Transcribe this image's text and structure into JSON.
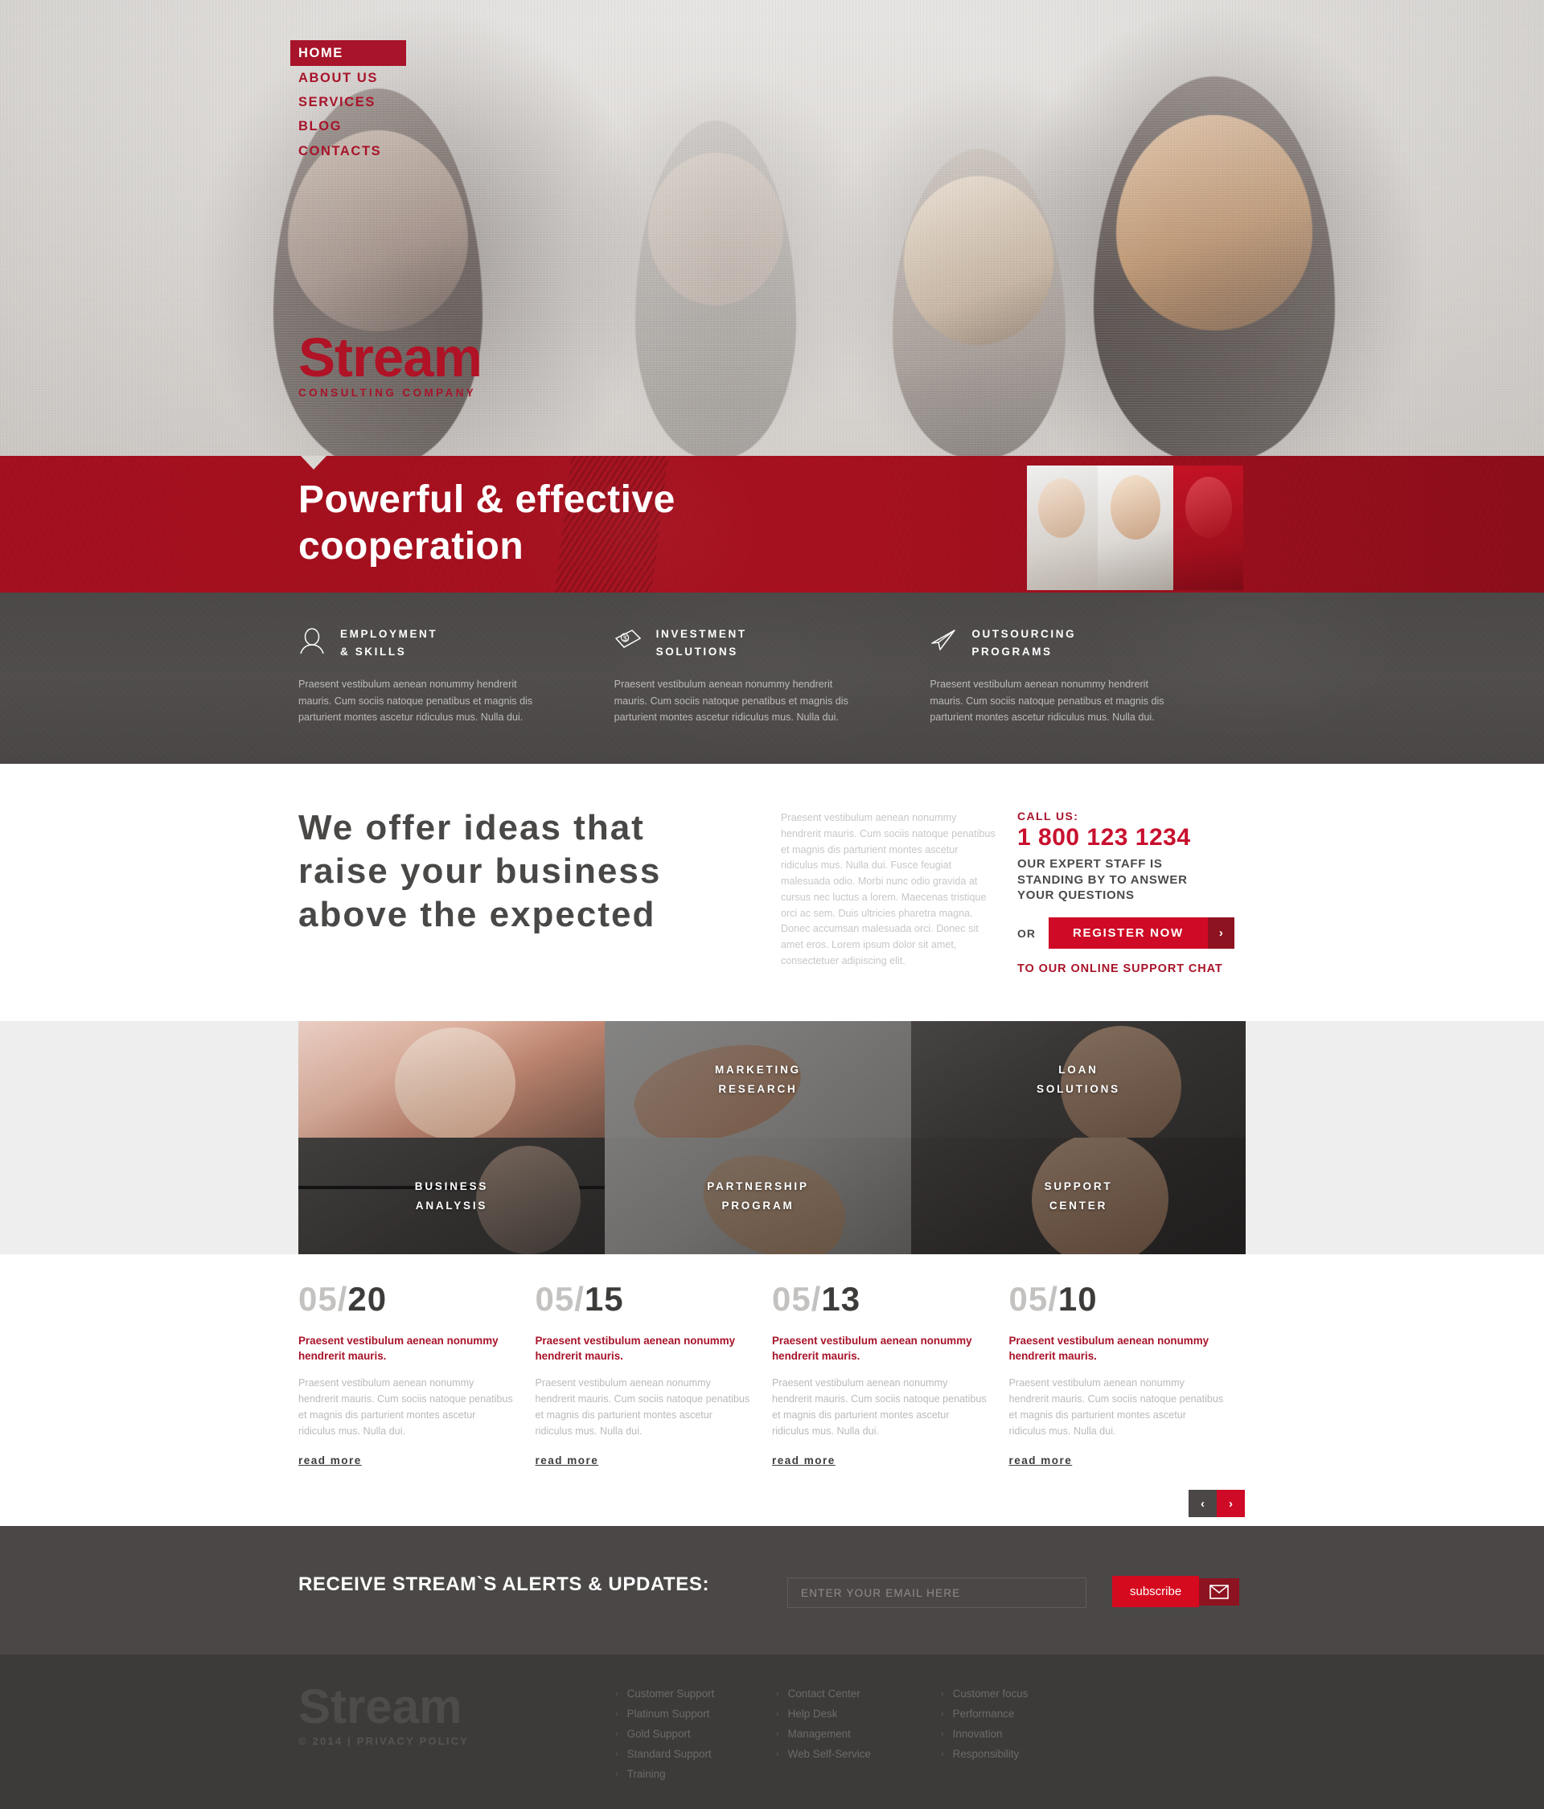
{
  "nav": {
    "items": [
      {
        "label": "HOME",
        "active": true
      },
      {
        "label": "ABOUT US",
        "active": false
      },
      {
        "label": "SERVICES",
        "active": false
      },
      {
        "label": "BLOG",
        "active": false
      },
      {
        "label": "CONTACTS",
        "active": false
      }
    ]
  },
  "logo": {
    "name": "Stream",
    "tagline": "CONSULTING COMPANY"
  },
  "banner": {
    "line1": "Powerful & effective",
    "line2": "cooperation"
  },
  "services": [
    {
      "icon": "person-icon",
      "title_line1": "EMPLOYMENT",
      "title_line2": "& SKILLS",
      "text": "Praesent vestibulum aenean nonummy hendrerit mauris. Cum sociis natoque penatibus et magnis dis parturient montes ascetur ridiculus mus. Nulla dui."
    },
    {
      "icon": "banknote-icon",
      "title_line1": "INVESTMENT",
      "title_line2": "SOLUTIONS",
      "text": "Praesent vestibulum aenean nonummy hendrerit mauris. Cum sociis natoque penatibus et magnis dis parturient montes ascetur ridiculus mus. Nulla dui."
    },
    {
      "icon": "paper-plane-icon",
      "title_line1": "OUTSOURCING",
      "title_line2": "PROGRAMS",
      "text": "Praesent vestibulum aenean nonummy hendrerit mauris. Cum sociis natoque penatibus et magnis dis parturient montes ascetur ridiculus mus. Nulla dui."
    }
  ],
  "offer": {
    "heading_line1": "We offer ideas that",
    "heading_line2": "raise your business",
    "heading_line3": "above the expected",
    "paragraph": "Praesent vestibulum aenean nonummy hendrerit mauris. Cum sociis natoque penatibus et magnis dis parturient montes ascetur ridiculus mus. Nulla dui. Fusce feugiat malesuada odio. Morbi nunc odio gravida at cursus nec luctus a lorem. Maecenas tristique orci ac sem. Duis ultricies pharetra magna. Donec accumsan malesuada orci. Donec sit amet eros. Lorem ipsum dolor sit amet, consectetuer adipiscing elit.",
    "call_label": "CALL US:",
    "phone": "1 800 123 1234",
    "call_desc_line1": "OUR EXPERT STAFF IS",
    "call_desc_line2": "STANDING BY TO ANSWER",
    "call_desc_line3": "YOUR QUESTIONS",
    "or_label": "OR",
    "register_label": "REGISTER NOW",
    "register_arrow": "›",
    "chat_label": "TO OUR ONLINE SUPPORT CHAT"
  },
  "gallery": [
    {
      "caption_line1": "",
      "caption_line2": "",
      "name": "smiling-woman-thumbs-up"
    },
    {
      "caption_line1": "MARKETING",
      "caption_line2": "RESEARCH",
      "name": "marketing-research"
    },
    {
      "caption_line1": "LOAN",
      "caption_line2": "SOLUTIONS",
      "name": "loan-solutions"
    },
    {
      "caption_line1": "BUSINESS",
      "caption_line2": "ANALYSIS",
      "name": "business-analysis"
    },
    {
      "caption_line1": "PARTNERSHIP",
      "caption_line2": "PROGRAM",
      "name": "partnership-program"
    },
    {
      "caption_line1": "SUPPORT",
      "caption_line2": "CENTER",
      "name": "support-center"
    }
  ],
  "news": {
    "items": [
      {
        "month": "05",
        "sep": "/",
        "day": "20",
        "title": "Praesent vestibulum aenean nonummy hendrerit mauris.",
        "text": "Praesent vestibulum aenean nonummy hendrerit mauris. Cum sociis natoque penatibus et magnis dis parturient montes ascetur ridiculus mus. Nulla dui.",
        "more": "read more"
      },
      {
        "month": "05",
        "sep": "/",
        "day": "15",
        "title": "Praesent vestibulum aenean nonummy hendrerit mauris.",
        "text": "Praesent vestibulum aenean nonummy hendrerit mauris. Cum sociis natoque penatibus et magnis dis parturient montes ascetur ridiculus mus. Nulla dui.",
        "more": "read more"
      },
      {
        "month": "05",
        "sep": "/",
        "day": "13",
        "title": "Praesent vestibulum aenean nonummy hendrerit mauris.",
        "text": "Praesent vestibulum aenean nonummy hendrerit mauris. Cum sociis natoque penatibus et magnis dis parturient montes ascetur ridiculus mus. Nulla dui.",
        "more": "read more"
      },
      {
        "month": "05",
        "sep": "/",
        "day": "10",
        "title": "Praesent vestibulum aenean nonummy hendrerit mauris.",
        "text": "Praesent vestibulum aenean nonummy hendrerit mauris. Cum sociis natoque penatibus et magnis dis parturient montes ascetur ridiculus mus. Nulla dui.",
        "more": "read more"
      }
    ],
    "pager": {
      "prev": "‹",
      "next": "›"
    }
  },
  "subscribe": {
    "title": "RECEIVE STREAM`S ALERTS & UPDATES:",
    "placeholder": "ENTER YOUR EMAIL HERE",
    "value": "",
    "button_label": "subscribe",
    "button_icon": "envelope-icon"
  },
  "footer": {
    "logo": "Stream",
    "copyright": "© 2014 | PRIVACY POLICY",
    "columns": [
      {
        "links": [
          "Customer Support",
          "Platinum Support",
          "Gold Support",
          "Standard Support",
          "Training"
        ]
      },
      {
        "links": [
          "Contact Center",
          "Help Desk",
          "Management",
          "Web Self-Service"
        ]
      },
      {
        "links": [
          "Customer focus",
          "Performance",
          "Innovation",
          "Responsibility"
        ]
      }
    ],
    "chevron": "›"
  },
  "colors": {
    "brand_red": "#a8142a",
    "accent_red": "#cf0a26",
    "dark_gray": "#4a4746",
    "footer_gray": "#3d3b3a",
    "light_gray": "#eeeeee"
  }
}
